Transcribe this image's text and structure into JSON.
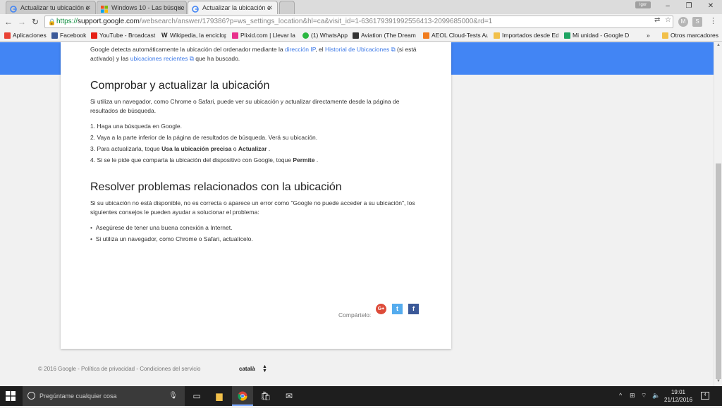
{
  "browser": {
    "tabs": [
      {
        "title": "Actualizar tu ubicación e"
      },
      {
        "title": "Windows 10 - Las búsque"
      },
      {
        "title": "Actualizar la ubicación e"
      }
    ],
    "user_badge": "Igor",
    "window_controls": {
      "minimize": "–",
      "maximize": "❐",
      "close": "✕"
    },
    "url_scheme": "https://",
    "url_host": "support.google.com",
    "url_path": "/websearch/answer/179386?p=ws_settings_location&hl=ca&visit_id=1-636179391992556413-2099685000&rd=1",
    "bookmarks": [
      {
        "label": "Aplicaciones",
        "color": "#e94235"
      },
      {
        "label": "Facebook",
        "color": "#3b5998"
      },
      {
        "label": "YouTube - Broadcast",
        "color": "#e62117"
      },
      {
        "label": "Wikipedia, la enciclop",
        "color": "#555555"
      },
      {
        "label": "Plixid.com | Llevar la",
        "color": "#e8308c"
      },
      {
        "label": "(1) WhatsApp",
        "color": "#2bb741"
      },
      {
        "label": "Aviation (The Dream",
        "color": "#333333"
      },
      {
        "label": "AEOL Cloud-Tests Aut",
        "color": "#f07c1e"
      },
      {
        "label": "Importados desde Ed",
        "color": "#f2c04a"
      },
      {
        "label": "Mi unidad - Google D",
        "color": "#1fa463"
      }
    ],
    "bookmarks_overflow": "»",
    "other_bookmarks": "Otros marcadores"
  },
  "article": {
    "intro_prefix": "Google detecta automáticamente la ubicación del ordenador mediante la",
    "intro_link_ip": "dirección IP",
    "intro_mid1": ", el",
    "intro_link_history": "Historial de Ubicaciones",
    "intro_mid2": "(si está activado) y las",
    "intro_link_recent": "ubicaciones recientes",
    "intro_suffix": "que ha buscado.",
    "section1_title": "Comprobar y actualizar la ubicación",
    "section1_text": "Si utiliza un navegador, como Chrome o Safari, puede ver su ubicación y actualizar directamente desde la página de resultados de búsqueda.",
    "steps": {
      "s1": "1. Haga una búsqueda en Google.",
      "s2": "2. Vaya a la parte inferior de la página de resultados de búsqueda. Verá su ubicación.",
      "s3_prefix": "3. Para actualizarla, toque",
      "s3_bold1": "Usa la ubicación precisa",
      "s3_mid": "o",
      "s3_bold2": "Actualizar",
      "s3_suffix": ".",
      "s4_prefix": "4. Si se le pide que comparta la ubicación del dispositivo con Google, toque",
      "s4_bold": "Permite",
      "s4_suffix": "."
    },
    "section2_title": "Resolver problemas relacionados con la ubicación",
    "section2_text": "Si su ubicación no está disponible, no es correcta o aparece un error como \"Google no puede acceder a su ubicación\", los siguientes consejos le pueden ayudar a solucionar el problema:",
    "tips": [
      "Asegúrese de tener una buena conexión a Internet.",
      "Si utiliza un navegador, como Chrome o Safari, actualícelo."
    ],
    "share_label": "Compártelo:",
    "share": {
      "gplus": "G+",
      "twitter": "t",
      "facebook": "f"
    }
  },
  "footer": {
    "copyright": "© 2016 Google",
    "privacy": "Política de privacidad",
    "terms": "Condiciones del servicio",
    "separator": " - ",
    "language": "català"
  },
  "taskbar": {
    "search_placeholder": "Pregúntame cualquier cosa",
    "time": "19:01",
    "date": "21/12/2016",
    "notification_count": "4"
  }
}
